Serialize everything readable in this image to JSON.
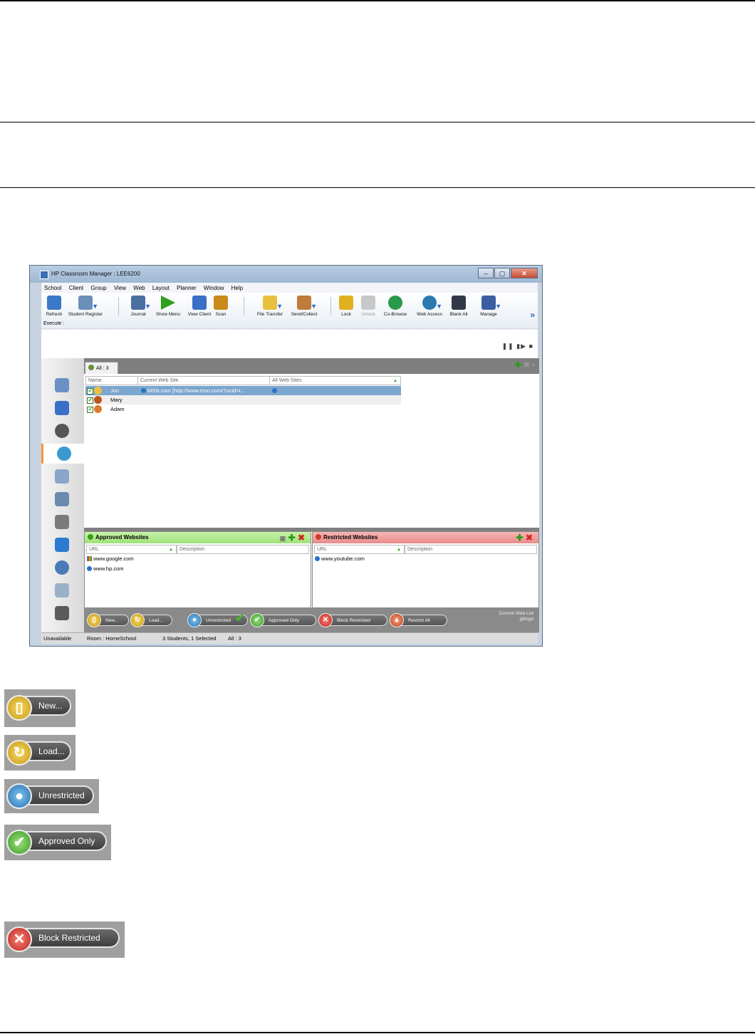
{
  "window": {
    "title": "HP Classroom Manager : LEE6200",
    "controls": [
      "–",
      "▢",
      "✕"
    ]
  },
  "menu": [
    "School",
    "Client",
    "Group",
    "View",
    "Web",
    "Layout",
    "Planner",
    "Window",
    "Help"
  ],
  "toolbar": {
    "buttons": [
      {
        "label": "Refresh",
        "icon": "users-refresh-icon",
        "color": "#3a78c8"
      },
      {
        "label": "Student Register",
        "icon": "register-icon",
        "color": "#6a8fb8"
      },
      {
        "label": "Journal",
        "icon": "journal-icon",
        "color": "#4a6fa0"
      },
      {
        "label": "Show Menu",
        "icon": "play-icon",
        "color": "#2ea01e"
      },
      {
        "label": "View Client",
        "icon": "view-client-icon",
        "color": "#3a6fc8"
      },
      {
        "label": "Scan",
        "icon": "scan-icon",
        "color": "#c88a1a"
      },
      {
        "label": "File Transfer",
        "icon": "file-transfer-icon",
        "color": "#e8c040"
      },
      {
        "label": "Send/Collect",
        "icon": "send-collect-icon",
        "color": "#c07a3a"
      },
      {
        "label": "Lock",
        "icon": "lock-icon",
        "color": "#e0b020"
      },
      {
        "label": "Unlock",
        "icon": "unlock-icon",
        "color": "#c8c8c8"
      },
      {
        "label": "Co-Browse",
        "icon": "co-browse-icon",
        "color": "#2a9a4a"
      },
      {
        "label": "Web Access",
        "icon": "web-access-icon",
        "color": "#2a7ab0"
      },
      {
        "label": "Blank All",
        "icon": "blank-all-icon",
        "color": "#303848"
      },
      {
        "label": "Manage",
        "icon": "manage-icon",
        "color": "#3a5fa0"
      }
    ],
    "more": "»",
    "execute_label": "Execute :"
  },
  "playback_controls": "❚❚ ▮▶ ■",
  "sidebar": {
    "items": [
      {
        "icon": "students-icon",
        "color": "#6b8fc7"
      },
      {
        "icon": "monitor-icon",
        "color": "#3a6fc8"
      },
      {
        "icon": "headset-icon",
        "color": "#555555"
      },
      {
        "icon": "web-globe-icon",
        "color": "#3a9ad0"
      },
      {
        "icon": "document-icon",
        "color": "#8aa6c8"
      },
      {
        "icon": "clipboard-icon",
        "color": "#6a8ab0"
      },
      {
        "icon": "printer-icon",
        "color": "#7a7a7a"
      },
      {
        "icon": "group-icon",
        "color": "#2a7ad0"
      },
      {
        "icon": "disc-icon",
        "color": "#4a7ab8"
      },
      {
        "icon": "eraser-icon",
        "color": "#9ab0c8"
      },
      {
        "icon": "whiteboard-icon",
        "color": "#5a5a5a"
      }
    ]
  },
  "main": {
    "tab_label": "All : 3",
    "columns": [
      "Name",
      "Current Web Site",
      "All Web Sites"
    ],
    "students": [
      {
        "name": "Jon",
        "current_site": "MSN.com [http://www.msn.com/?ocid=i...",
        "selected": true
      },
      {
        "name": "Mary",
        "current_site": ""
      },
      {
        "name": "Adam",
        "current_site": ""
      }
    ],
    "approved": {
      "title": "Approved Websites",
      "columns": [
        "URL",
        "Description"
      ],
      "urls": [
        "www.google.com",
        "www.hp.com"
      ]
    },
    "restricted": {
      "title": "Restricted Websites",
      "columns": [
        "URL",
        "Description"
      ],
      "urls": [
        "www.youtube.com"
      ]
    },
    "bottom_buttons": {
      "new": "New...",
      "load": "Load...",
      "unrestricted": "Unrestricted",
      "approved_only": "Approved Only",
      "block_restricted": "Block Restricted",
      "restrict_all": "Restrict All"
    },
    "current_list_label": "Current Web List",
    "current_list_value": "gfdsgd"
  },
  "status": {
    "state": "Unavailable",
    "room": "Room : HomeSchool",
    "students": "3 Students, 1 Selected",
    "all": "All : 3"
  },
  "large_buttons": {
    "new": "New...",
    "load": "Load...",
    "unrestricted": "Unrestricted",
    "approved_only": "Approved Only",
    "block_restricted": "Block Restricted"
  }
}
